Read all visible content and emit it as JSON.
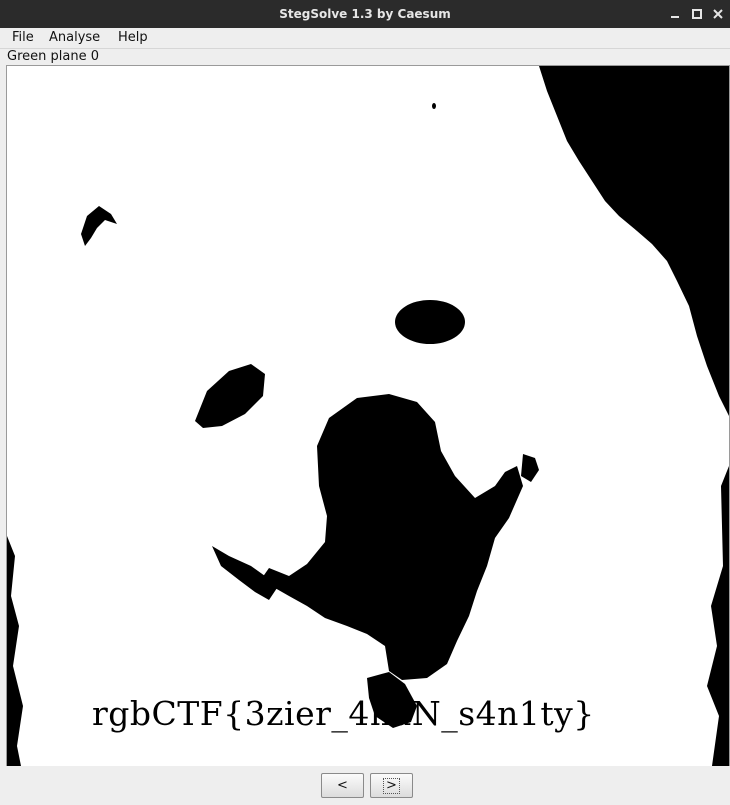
{
  "window": {
    "title": "StegSolve 1.3 by Caesum",
    "controls": [
      "minimize-icon",
      "maximize-icon",
      "close-icon"
    ]
  },
  "menu": {
    "file": "File",
    "analyse": "Analyse",
    "help": "Help"
  },
  "plane_label": "Green plane 0",
  "image": {
    "flag_text": "rgbCTF{3zier_4haN_s4n1ty}",
    "subject": "bit-plane render of a white fluffy dog",
    "colors": {
      "background": "#ffffff",
      "foreground": "#000000"
    }
  },
  "nav": {
    "prev_label": "<",
    "next_label": ">"
  },
  "colors": {
    "titlebar": "#2b2b2b",
    "window_bg": "#eeeeee"
  }
}
